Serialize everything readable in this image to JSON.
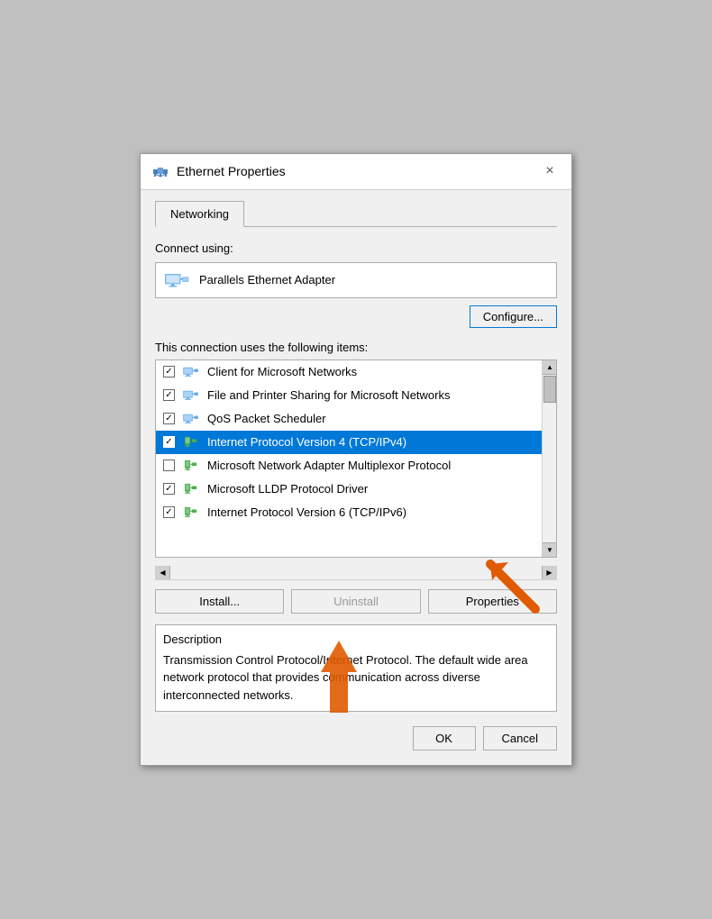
{
  "window": {
    "title": "Ethernet Properties",
    "close_label": "×"
  },
  "tabs": [
    {
      "label": "Networking",
      "active": true
    }
  ],
  "connect_using_label": "Connect using:",
  "adapter": {
    "name": "Parallels Ethernet Adapter"
  },
  "configure_button": "Configure...",
  "connection_items_label": "This connection uses the following items:",
  "items": [
    {
      "checked": true,
      "label": "Client for Microsoft Networks",
      "icon_type": "network"
    },
    {
      "checked": true,
      "label": "File and Printer Sharing for Microsoft Networks",
      "icon_type": "network"
    },
    {
      "checked": true,
      "label": "QoS Packet Scheduler",
      "icon_type": "network"
    },
    {
      "checked": true,
      "label": "Internet Protocol Version 4 (TCP/IPv4)",
      "icon_type": "green",
      "selected": true
    },
    {
      "checked": false,
      "label": "Microsoft Network Adapter Multiplexor Protocol",
      "icon_type": "green"
    },
    {
      "checked": true,
      "label": "Microsoft LLDP Protocol Driver",
      "icon_type": "green"
    },
    {
      "checked": true,
      "label": "Internet Protocol Version 6 (TCP/IPv6)",
      "icon_type": "green"
    }
  ],
  "buttons": {
    "install": "Install...",
    "uninstall": "Uninstall",
    "properties": "Properties"
  },
  "description": {
    "title": "Description",
    "text": "Transmission Control Protocol/Internet Protocol. The default wide area network protocol that provides communication across diverse interconnected networks."
  },
  "ok_label": "OK",
  "cancel_label": "Cancel",
  "colors": {
    "selected_bg": "#0078d7",
    "configure_border": "#0078d7",
    "orange_arrow": "#e05a00"
  }
}
